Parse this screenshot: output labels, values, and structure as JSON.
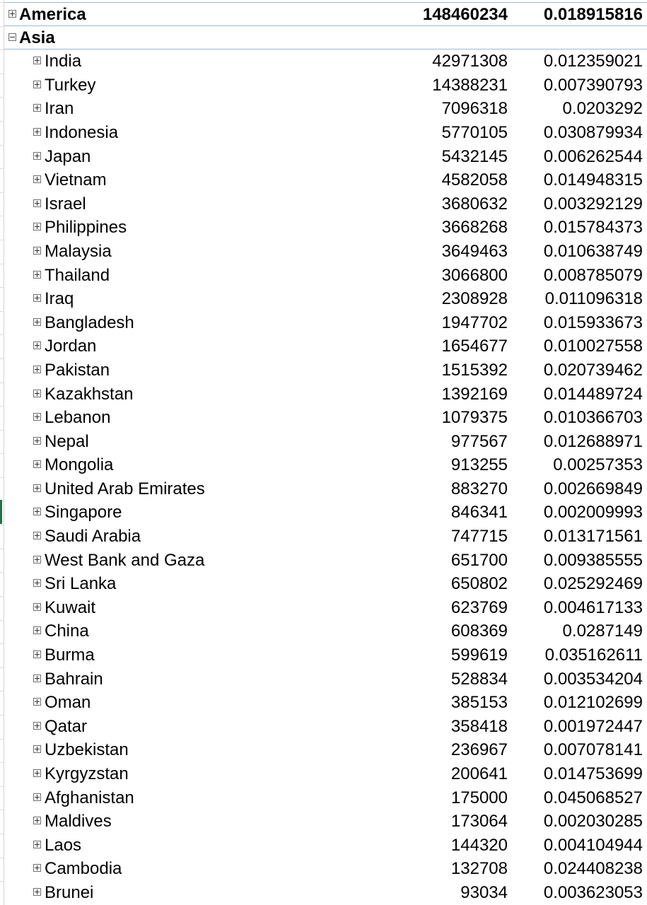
{
  "rows": [
    {
      "label": "America",
      "value": "148460234",
      "share": "0.018915816",
      "level": 0,
      "expanded": false,
      "bold": true
    },
    {
      "label": "Asia",
      "value": "",
      "share": "",
      "level": 0,
      "expanded": true,
      "bold": true
    },
    {
      "label": "India",
      "value": "42971308",
      "share": "0.012359021",
      "level": 1,
      "expanded": false
    },
    {
      "label": "Turkey",
      "value": "14388231",
      "share": "0.007390793",
      "level": 1,
      "expanded": false
    },
    {
      "label": "Iran",
      "value": "7096318",
      "share": "0.0203292",
      "level": 1,
      "expanded": false
    },
    {
      "label": "Indonesia",
      "value": "5770105",
      "share": "0.030879934",
      "level": 1,
      "expanded": false
    },
    {
      "label": "Japan",
      "value": "5432145",
      "share": "0.006262544",
      "level": 1,
      "expanded": false
    },
    {
      "label": "Vietnam",
      "value": "4582058",
      "share": "0.014948315",
      "level": 1,
      "expanded": false
    },
    {
      "label": "Israel",
      "value": "3680632",
      "share": "0.003292129",
      "level": 1,
      "expanded": false
    },
    {
      "label": "Philippines",
      "value": "3668268",
      "share": "0.015784373",
      "level": 1,
      "expanded": false
    },
    {
      "label": "Malaysia",
      "value": "3649463",
      "share": "0.010638749",
      "level": 1,
      "expanded": false
    },
    {
      "label": "Thailand",
      "value": "3066800",
      "share": "0.008785079",
      "level": 1,
      "expanded": false
    },
    {
      "label": "Iraq",
      "value": "2308928",
      "share": "0.011096318",
      "level": 1,
      "expanded": false
    },
    {
      "label": "Bangladesh",
      "value": "1947702",
      "share": "0.015933673",
      "level": 1,
      "expanded": false
    },
    {
      "label": "Jordan",
      "value": "1654677",
      "share": "0.010027558",
      "level": 1,
      "expanded": false
    },
    {
      "label": "Pakistan",
      "value": "1515392",
      "share": "0.020739462",
      "level": 1,
      "expanded": false
    },
    {
      "label": "Kazakhstan",
      "value": "1392169",
      "share": "0.014489724",
      "level": 1,
      "expanded": false
    },
    {
      "label": "Lebanon",
      "value": "1079375",
      "share": "0.010366703",
      "level": 1,
      "expanded": false
    },
    {
      "label": "Nepal",
      "value": "977567",
      "share": "0.012688971",
      "level": 1,
      "expanded": false
    },
    {
      "label": "Mongolia",
      "value": "913255",
      "share": "0.00257353",
      "level": 1,
      "expanded": false
    },
    {
      "label": "United Arab Emirates",
      "value": "883270",
      "share": "0.002669849",
      "level": 1,
      "expanded": false
    },
    {
      "label": "Singapore",
      "value": "846341",
      "share": "0.002009993",
      "level": 1,
      "expanded": false
    },
    {
      "label": "Saudi Arabia",
      "value": "747715",
      "share": "0.013171561",
      "level": 1,
      "expanded": false
    },
    {
      "label": "West Bank and Gaza",
      "value": "651700",
      "share": "0.009385555",
      "level": 1,
      "expanded": false
    },
    {
      "label": "Sri Lanka",
      "value": "650802",
      "share": "0.025292469",
      "level": 1,
      "expanded": false
    },
    {
      "label": "Kuwait",
      "value": "623769",
      "share": "0.004617133",
      "level": 1,
      "expanded": false
    },
    {
      "label": "China",
      "value": "608369",
      "share": "0.0287149",
      "level": 1,
      "expanded": false
    },
    {
      "label": "Burma",
      "value": "599619",
      "share": "0.035162611",
      "level": 1,
      "expanded": false
    },
    {
      "label": "Bahrain",
      "value": "528834",
      "share": "0.003534204",
      "level": 1,
      "expanded": false
    },
    {
      "label": "Oman",
      "value": "385153",
      "share": "0.012102699",
      "level": 1,
      "expanded": false
    },
    {
      "label": "Qatar",
      "value": "358418",
      "share": "0.001972447",
      "level": 1,
      "expanded": false
    },
    {
      "label": "Uzbekistan",
      "value": "236967",
      "share": "0.007078141",
      "level": 1,
      "expanded": false
    },
    {
      "label": "Kyrgyzstan",
      "value": "200641",
      "share": "0.014753699",
      "level": 1,
      "expanded": false
    },
    {
      "label": "Afghanistan",
      "value": "175000",
      "share": "0.045068527",
      "level": 1,
      "expanded": false
    },
    {
      "label": "Maldives",
      "value": "173064",
      "share": "0.002030285",
      "level": 1,
      "expanded": false
    },
    {
      "label": "Laos",
      "value": "144320",
      "share": "0.004104944",
      "level": 1,
      "expanded": false
    },
    {
      "label": "Cambodia",
      "value": "132708",
      "share": "0.024408238",
      "level": 1,
      "expanded": false
    },
    {
      "label": "Brunei",
      "value": "93034",
      "share": "0.003623053",
      "level": 1,
      "expanded": false
    }
  ]
}
